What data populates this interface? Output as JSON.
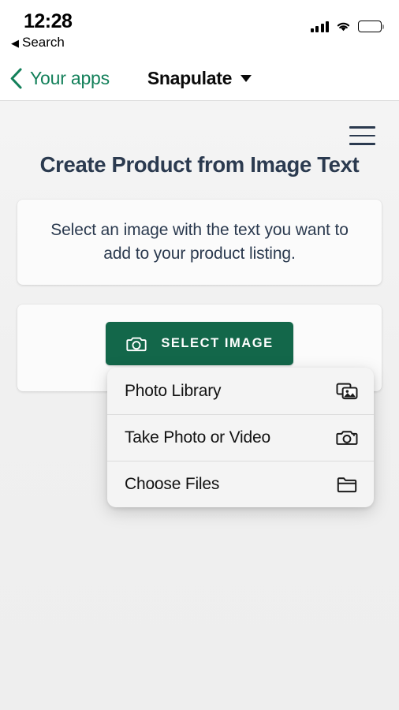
{
  "status_bar": {
    "time": "12:28",
    "back_app_label": "Search",
    "back_caret_glyph": "◀",
    "signal_icon": "cellular-signal-icon",
    "wifi_icon": "wifi-icon",
    "battery_icon": "battery-full-icon"
  },
  "nav_bar": {
    "back_label": "Your apps",
    "back_icon": "chevron-left-icon",
    "title": "Snapulate",
    "dropdown_icon": "caret-down-icon"
  },
  "page": {
    "menu_icon": "hamburger-menu-icon",
    "title": "Create Product from Image Text",
    "instruction": "Select an image with the text you want to add to your product listing."
  },
  "select_button": {
    "label": "SELECT IMAGE",
    "icon": "camera-icon"
  },
  "action_sheet": {
    "items": [
      {
        "label": "Photo Library",
        "icon": "photo-library-icon"
      },
      {
        "label": "Take Photo or Video",
        "icon": "camera-icon"
      },
      {
        "label": "Choose Files",
        "icon": "folder-icon"
      }
    ]
  },
  "colors": {
    "brand_green": "#13805a",
    "button_green": "#13674a",
    "title_navy": "#2b3a4f",
    "page_background": "#f1f1f1",
    "card_background": "#fbfbfb",
    "menu_background": "#f4f4f4"
  }
}
